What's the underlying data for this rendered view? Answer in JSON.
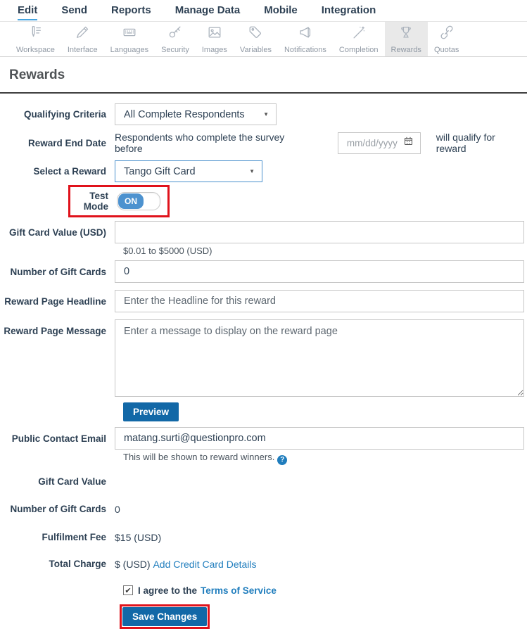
{
  "nav": {
    "items": [
      {
        "label": "Edit",
        "active": true
      },
      {
        "label": "Send",
        "active": false
      },
      {
        "label": "Reports",
        "active": false
      },
      {
        "label": "Manage Data",
        "active": false
      },
      {
        "label": "Mobile",
        "active": false
      },
      {
        "label": "Integration",
        "active": false
      }
    ]
  },
  "toolbar": {
    "items": [
      {
        "label": "Workspace",
        "icon": "workspace-icon",
        "active": false
      },
      {
        "label": "Interface",
        "icon": "interface-icon",
        "active": false
      },
      {
        "label": "Languages",
        "icon": "languages-icon",
        "active": false
      },
      {
        "label": "Security",
        "icon": "security-icon",
        "active": false
      },
      {
        "label": "Images",
        "icon": "images-icon",
        "active": false
      },
      {
        "label": "Variables",
        "icon": "variables-icon",
        "active": false
      },
      {
        "label": "Notifications",
        "icon": "notifications-icon",
        "active": false
      },
      {
        "label": "Completion",
        "icon": "completion-icon",
        "active": false
      },
      {
        "label": "Rewards",
        "icon": "rewards-icon",
        "active": true
      },
      {
        "label": "Quotas",
        "icon": "quotas-icon",
        "active": false
      }
    ]
  },
  "page": {
    "title": "Rewards"
  },
  "form": {
    "qualifying_criteria": {
      "label": "Qualifying Criteria",
      "value": "All Complete Respondents"
    },
    "reward_end_date": {
      "label": "Reward End Date",
      "prefix": "Respondents who complete the survey before",
      "placeholder": "mm/dd/yyyy",
      "suffix": "will qualify for reward"
    },
    "select_reward": {
      "label": "Select a Reward",
      "value": "Tango Gift Card"
    },
    "test_mode": {
      "label": "Test Mode",
      "state": "ON"
    },
    "gift_card_value": {
      "label": "Gift Card Value (USD)",
      "value": "",
      "helper": "$0.01 to $5000 (USD)"
    },
    "number_gift_cards": {
      "label": "Number of Gift Cards",
      "value": "0"
    },
    "headline": {
      "label": "Reward Page Headline",
      "placeholder": "Enter the Headline for this reward"
    },
    "message": {
      "label": "Reward Page Message",
      "placeholder": "Enter a message to display on the reward page"
    },
    "preview_button": "Preview",
    "contact_email": {
      "label": "Public Contact Email",
      "value": "matang.surti@questionpro.com",
      "helper": "This will be shown to reward winners.",
      "help_icon": "question-circle-icon"
    },
    "summary": {
      "gift_card_value": {
        "label": "Gift Card Value",
        "value": ""
      },
      "number_gift_cards": {
        "label": "Number of Gift Cards",
        "value": "0"
      },
      "fulfilment_fee": {
        "label": "Fulfilment Fee",
        "value": "$15 (USD)"
      },
      "total_charge": {
        "label": "Total Charge",
        "value": "$ (USD)",
        "link": "Add Credit Card Details"
      }
    },
    "agree": {
      "text": "I agree to the",
      "link": "Terms of Service",
      "checked": true,
      "check_glyph": "✔"
    },
    "save_button": "Save Changes"
  },
  "colors": {
    "accent_blue": "#1268a7",
    "link_blue": "#1f7dbd",
    "toggle_blue": "#4d92cf",
    "annotation_red": "#e0121b"
  }
}
